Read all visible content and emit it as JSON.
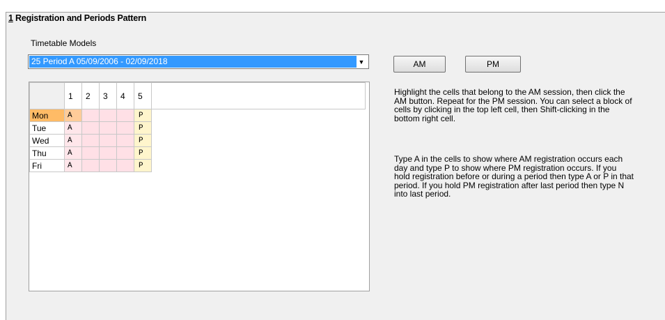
{
  "section": {
    "number": "1",
    "title": " Registration and Periods Pattern"
  },
  "models": {
    "label": "Timetable Models",
    "selected": "25 Period A 05/09/2006 - 02/09/2018"
  },
  "buttons": {
    "am": "AM",
    "pm": "PM"
  },
  "grid": {
    "columns": [
      "1",
      "2",
      "3",
      "4",
      "5"
    ],
    "rows": [
      {
        "day": "Mon",
        "cells": [
          "A",
          "",
          "",
          "",
          "P"
        ]
      },
      {
        "day": "Tue",
        "cells": [
          "A",
          "",
          "",
          "",
          "P"
        ]
      },
      {
        "day": "Wed",
        "cells": [
          "A",
          "",
          "",
          "",
          "P"
        ]
      },
      {
        "day": "Thu",
        "cells": [
          "A",
          "",
          "",
          "",
          "P"
        ]
      },
      {
        "day": "Fri",
        "cells": [
          "A",
          "",
          "",
          "",
          "P"
        ]
      }
    ]
  },
  "help": {
    "para1": "Highlight the cells that belong to the AM session, then click the AM button. Repeat for the PM session. You can select a block of cells by clicking in the top left cell, then Shift-clicking in the bottom right cell.",
    "para2": "Type A in the cells to show where AM registration occurs each day and type P to show where PM registration occurs. If you hold registration before or during a period then type A or P in that period. If you hold PM registration after last period then type N into last period."
  },
  "colors": {
    "selection": "#3399ff",
    "am_cell": "#ffe6ea",
    "pm_cell": "#fff5cc",
    "active_row_header": "#ffbb66"
  }
}
